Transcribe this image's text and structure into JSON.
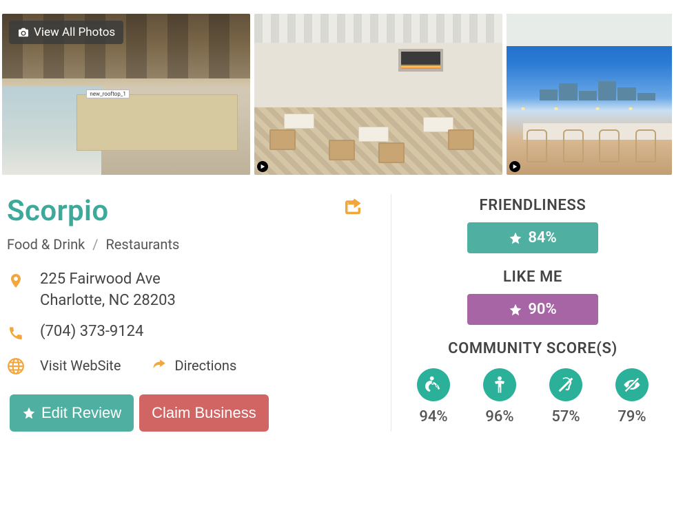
{
  "gallery": {
    "view_all_label": "View All Photos",
    "photo1_label": "new_rooftop_1"
  },
  "business": {
    "name": "Scorpio",
    "breadcrumb": {
      "category": "Food & Drink",
      "sub": "Restaurants"
    },
    "address_line1": "225 Fairwood Ave",
    "address_line2": "Charlotte, NC 28203",
    "phone": "(704) 373-9124",
    "website_label": "Visit WebSite",
    "directions_label": "Directions"
  },
  "actions": {
    "edit_review": "Edit Review",
    "claim_business": "Claim Business"
  },
  "metrics": {
    "friendliness": {
      "title": "FRIENDLINESS",
      "value": "84%"
    },
    "like_me": {
      "title": "LIKE ME",
      "value": "90%"
    },
    "community_title": "COMMUNITY SCORE(S)",
    "community": {
      "mobility": "94%",
      "cognitive": "96%",
      "hearing": "57%",
      "vision": "79%"
    }
  }
}
